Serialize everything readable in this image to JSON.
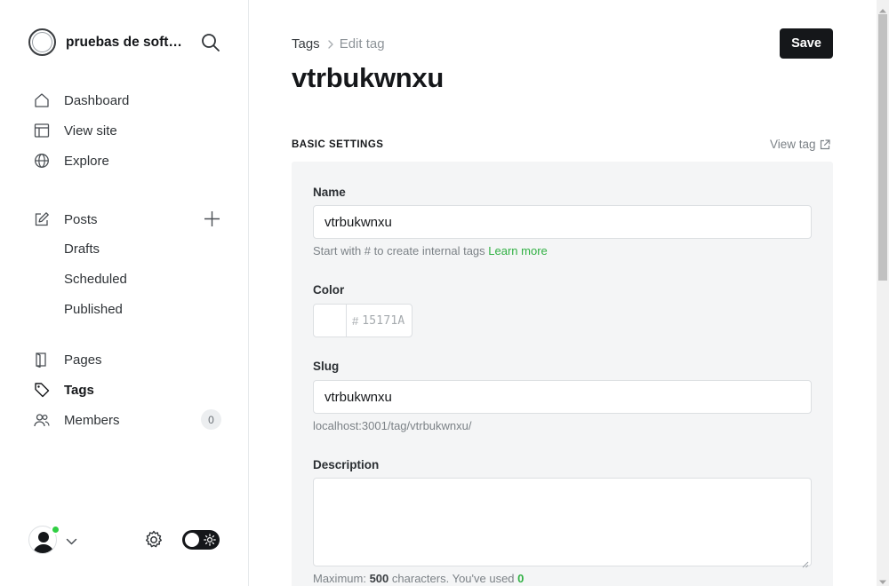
{
  "brand": {
    "name": "pruebas de soft…",
    "icon": "site-logo"
  },
  "sidebar": {
    "nav": [
      {
        "label": "Dashboard",
        "icon": "home-icon"
      },
      {
        "label": "View site",
        "icon": "layout-icon"
      },
      {
        "label": "Explore",
        "icon": "globe-icon"
      }
    ],
    "posts": {
      "label": "Posts",
      "icon": "edit-icon",
      "sub": [
        "Drafts",
        "Scheduled",
        "Published"
      ]
    },
    "more": [
      {
        "label": "Pages",
        "icon": "page-icon"
      },
      {
        "label": "Tags",
        "icon": "tag-icon",
        "active": true
      },
      {
        "label": "Members",
        "icon": "members-icon",
        "count": "0"
      }
    ]
  },
  "breadcrumb": {
    "parent": "Tags",
    "current": "Edit tag"
  },
  "page": {
    "title": "vtrbukwnxu",
    "save_label": "Save"
  },
  "section": {
    "title": "BASIC SETTINGS",
    "view_tag": "View tag"
  },
  "form": {
    "name": {
      "label": "Name",
      "value": "vtrbukwnxu",
      "hint": "Start with # to create internal tags",
      "hint_link": "Learn more"
    },
    "color": {
      "label": "Color",
      "hash": "#",
      "value": "15171A"
    },
    "slug": {
      "label": "Slug",
      "value": "vtrbukwnxu",
      "url": "localhost:3001/tag/vtrbukwnxu/"
    },
    "description": {
      "label": "Description",
      "value": "",
      "counter_prefix": "Maximum:",
      "max": "500",
      "counter_mid": "characters. You've used",
      "used": "0"
    }
  },
  "colors": {
    "accent_green": "#30cf43",
    "link_green": "#30b043",
    "dark": "#15171a",
    "panel": "#f4f5f6"
  }
}
